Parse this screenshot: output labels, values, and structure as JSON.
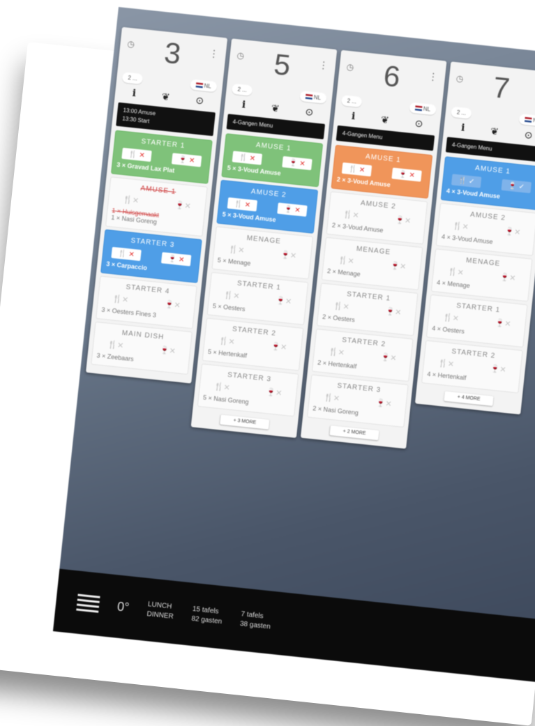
{
  "columns": [
    {
      "number": "3",
      "pill_left": "2 ...",
      "pill_right": "NL",
      "black_lines": [
        "13:00 Amuse",
        "13:30 Start"
      ],
      "cards": [
        {
          "style": "green",
          "title": "STARTER 1",
          "chip1": "🍴 ✕",
          "chip2": "🍷 ✕",
          "desc": "3 × Gravad Lax Plat"
        },
        {
          "style": "plain-struck",
          "title": "AMUSE 1",
          "desc": "1 × Huisgemaakt",
          "desc2": "1 × Nasi Goreng"
        },
        {
          "style": "blue",
          "title": "STARTER 3",
          "chip1": "🍴 ✕",
          "chip2": "🍷 ✕",
          "desc": "3 × Carpaccio"
        },
        {
          "style": "plain",
          "title": "STARTER 4",
          "desc": "3 × Oesters Fines 3"
        },
        {
          "style": "plain",
          "title": "MAIN DISH",
          "desc": "3 × Zeebaars"
        }
      ],
      "more": ""
    },
    {
      "number": "5",
      "pill_left": "2 ...",
      "pill_right": "NL",
      "black_lines": [
        "4-Gangen Menu"
      ],
      "cards": [
        {
          "style": "green",
          "title": "AMUSE 1",
          "chip1": "🍴 ✕",
          "chip2": "🍷 ✕",
          "desc": "5 × 3-Voud Amuse"
        },
        {
          "style": "blue",
          "title": "AMUSE 2",
          "chip1": "🍴 ✕",
          "chip2": "🍷 ✕",
          "desc": "5 × 3-Voud Amuse"
        },
        {
          "style": "plain",
          "title": "MENAGE",
          "desc": "5 × Menage"
        },
        {
          "style": "plain",
          "title": "STARTER 1",
          "desc": "5 × Oesters"
        },
        {
          "style": "plain",
          "title": "STARTER 2",
          "desc": "5 × Hertenkalf"
        },
        {
          "style": "plain",
          "title": "STARTER 3",
          "desc": "5 × Nasi Goreng"
        }
      ],
      "more": "+ 3 MORE"
    },
    {
      "number": "6",
      "pill_left": "2 ...",
      "pill_right": "NL",
      "black_lines": [
        "4-Gangen Menu"
      ],
      "cards": [
        {
          "style": "orange",
          "title": "AMUSE 1",
          "chip1": "🍴 ✕",
          "chip2": "🍷 ✕",
          "desc": "2 × 3-Voud Amuse"
        },
        {
          "style": "plain",
          "title": "AMUSE 2",
          "desc": "2 × 3-Voud Amuse"
        },
        {
          "style": "plain",
          "title": "MENAGE",
          "desc": "2 × Menage"
        },
        {
          "style": "plain",
          "title": "STARTER 1",
          "desc": "2 × Oesters"
        },
        {
          "style": "plain",
          "title": "STARTER 2",
          "desc": "2 × Hertenkalf"
        },
        {
          "style": "plain",
          "title": "STARTER 3",
          "desc": "2 × Nasi Goreng"
        }
      ],
      "more": "+ 2 MORE"
    },
    {
      "number": "7",
      "pill_left": "2 ...",
      "pill_right": "NL",
      "black_lines": [
        "4-Gangen Menu"
      ],
      "cards": [
        {
          "style": "blue",
          "title": "AMUSE 1",
          "chip1": "🍴 ✓",
          "chip2": "🍷 ✓",
          "desc": "4 × 3-Voud Amuse",
          "ok": true
        },
        {
          "style": "plain",
          "title": "AMUSE 2",
          "desc": "4 × 3-Voud Amuse"
        },
        {
          "style": "plain",
          "title": "MENAGE",
          "desc": "4 × Menage"
        },
        {
          "style": "plain",
          "title": "STARTER 1",
          "desc": "4 × Oesters"
        },
        {
          "style": "plain",
          "title": "STARTER 2",
          "desc": "4 × Hertenkalf"
        }
      ],
      "more": "+ 4 MORE"
    }
  ],
  "bottom_bar": {
    "temp": "0°",
    "item1_l1": "LUNCH",
    "item1_l2": "DINNER",
    "item2_l1": "15 tafels",
    "item2_l2": "82 gasten",
    "item3_l1": "7 tafels",
    "item3_l2": "38 gasten"
  }
}
